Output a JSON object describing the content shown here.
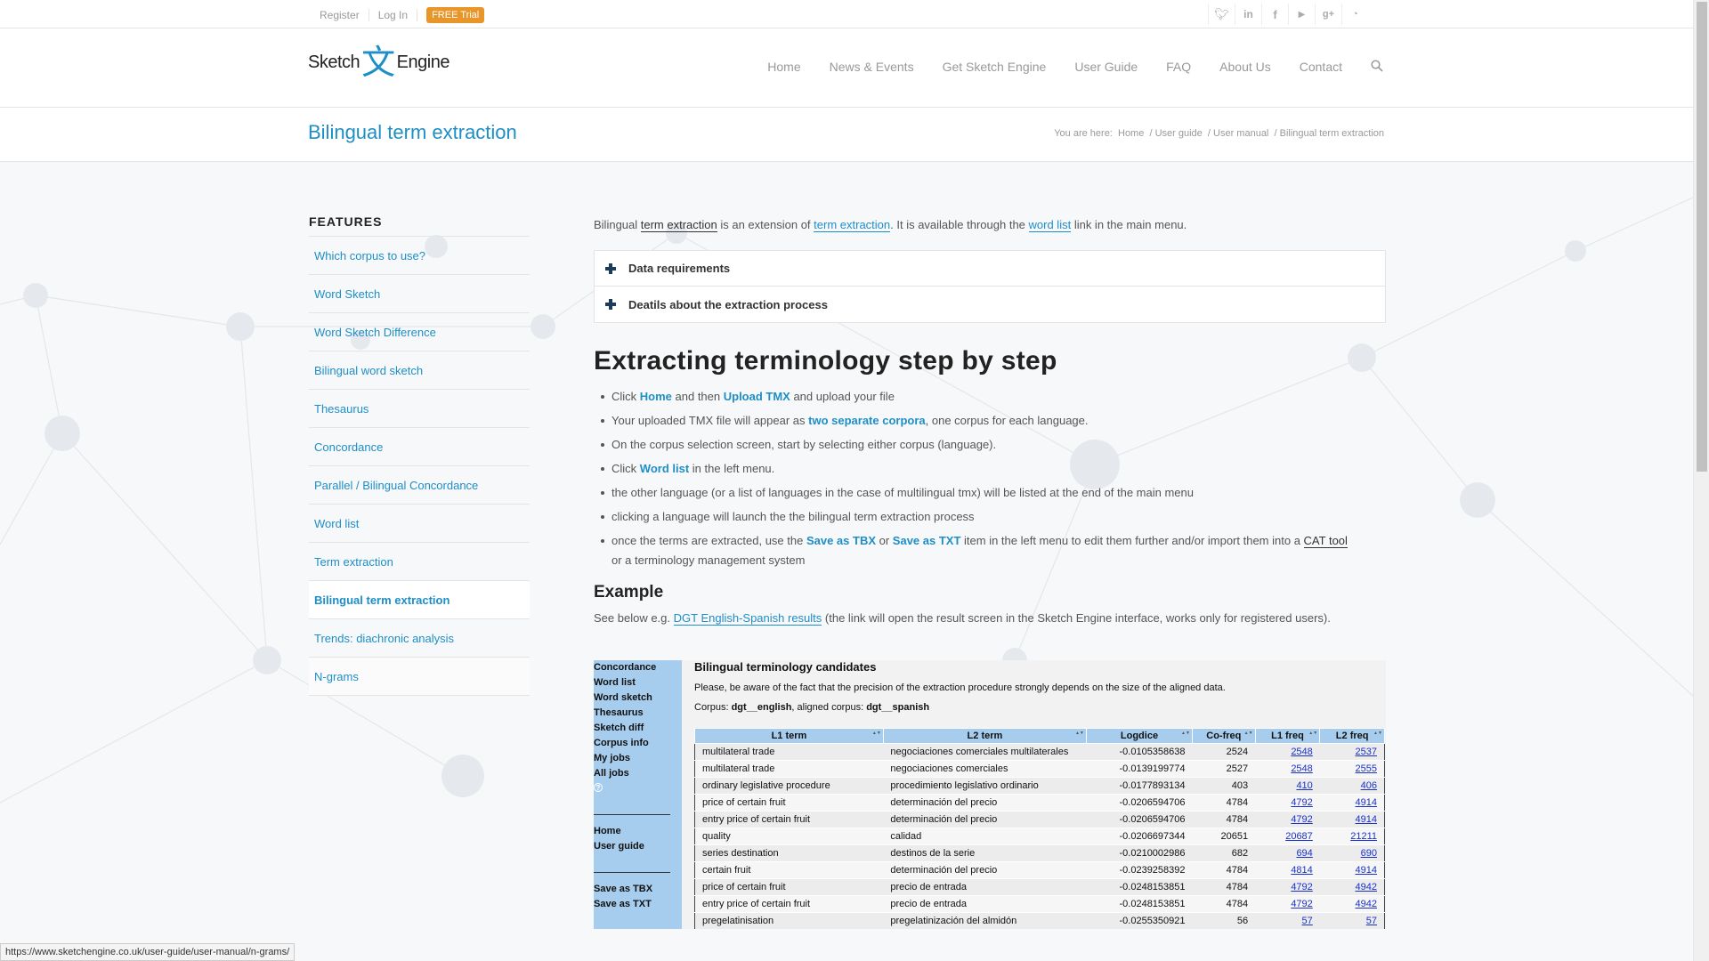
{
  "topbar": {
    "register": "Register",
    "login": "Log In",
    "trial": "FREE Trial",
    "social": [
      "twitter-icon",
      "linkedin-icon",
      "facebook-icon",
      "youtube-icon",
      "googleplus-icon",
      "rss-icon"
    ]
  },
  "logo": {
    "part1": "Sketch",
    "mark": "文",
    "part2": "Engine"
  },
  "nav": [
    "Home",
    "News & Events",
    "Get Sketch Engine",
    "User Guide",
    "FAQ",
    "About Us",
    "Contact"
  ],
  "page": {
    "title": "Bilingual term extraction"
  },
  "breadcrumb": {
    "prefix": "You are here:",
    "items": [
      "Home",
      "User guide",
      "User manual",
      "Bilingual term extraction"
    ]
  },
  "sidebar": {
    "heading": "FEATURES",
    "items": [
      "Which corpus to use?",
      "Word Sketch",
      "Word Sketch Difference",
      "Bilingual word sketch",
      "Thesaurus",
      "Concordance",
      "Parallel / Bilingual Concordance",
      "Word list",
      "Term extraction",
      "Bilingual term extraction",
      "Trends: diachronic analysis",
      "N-grams"
    ]
  },
  "intro": {
    "t1": "Bilingual ",
    "l1": "term extraction",
    "t2": " is an extension of ",
    "l2": "term extraction",
    "t3": ". It is available through the ",
    "l3": "word list",
    "t4": " link in the main menu."
  },
  "toggles": [
    "Data requirements",
    "Deatils about the extraction process"
  ],
  "section_title": "Extracting terminology step by step",
  "steps": {
    "s1a": "Click ",
    "s1b": "Home",
    "s1c": " and then ",
    "s1d": "Upload TMX",
    "s1e": " and upload your file",
    "s2a": "Your uploaded TMX file will appear as ",
    "s2b": "two separate corpora",
    "s2c": ", one corpus for each language.",
    "s3": "On the corpus selection screen, start by selecting either corpus (language).",
    "s4a": "Click ",
    "s4b": "Word list",
    "s4c": " in the left menu.",
    "s5": "the other language (or a list of languages in the case of multilingual tmx) will be listed at the end of the main menu",
    "s6": "clicking a language will launch the the bilingual term extraction process",
    "s7a": "once the terms are extracted, use the ",
    "s7b": "Save as TBX",
    "s7c": " or ",
    "s7d": "Save as TXT",
    "s7e": " item in the left menu to edit them further and/or import them into a ",
    "s7f": "CAT tool",
    "s7g": " or a terminology management system"
  },
  "example": {
    "title": "Example",
    "t1": "See below e.g. ",
    "link": "DGT English-Spanish results",
    "t2": " (the link will open the result screen in the Sketch Engine interface, works only for registered users)."
  },
  "screenshot": {
    "menu_top": [
      "Concordance",
      "Word list",
      "Word sketch",
      "Thesaurus",
      "Sketch diff",
      "Corpus info",
      "My jobs",
      "All jobs"
    ],
    "help": "?",
    "menu_mid": [
      "Home",
      "User guide"
    ],
    "menu_bot": [
      "Save as TBX",
      "Save as TXT"
    ],
    "title": "Bilingual terminology candidates",
    "note": "Please, be aware of the fact that the precision of the extraction procedure strongly depends on the size of the aligned data.",
    "corpus_prefix": "Corpus: ",
    "corpus": "dgt__english",
    "aligned_prefix": ", aligned corpus: ",
    "aligned": "dgt__spanish",
    "headers": [
      "L1 term",
      "L2 term",
      "Logdice",
      "Co-freq",
      "L1 freq",
      "L2 freq"
    ],
    "rows": [
      [
        "multilateral trade",
        "negociaciones comerciales multilaterales",
        "-0.0105358638",
        "2524",
        "2548",
        "2537"
      ],
      [
        "multilateral trade",
        "negociaciones comerciales",
        "-0.0139199774",
        "2527",
        "2548",
        "2555"
      ],
      [
        "ordinary legislative procedure",
        "procedimiento legislativo ordinario",
        "-0.0177893134",
        "403",
        "410",
        "406"
      ],
      [
        "price of certain fruit",
        "determinación del precio",
        "-0.0206594706",
        "4784",
        "4792",
        "4914"
      ],
      [
        "entry price of certain fruit",
        "determinación del precio",
        "-0.0206594706",
        "4784",
        "4792",
        "4914"
      ],
      [
        "quality",
        "calidad",
        "-0.0206697344",
        "20651",
        "20687",
        "21211"
      ],
      [
        "series destination",
        "destinos de la serie",
        "-0.0210002986",
        "682",
        "694",
        "690"
      ],
      [
        "certain fruit",
        "determinación del precio",
        "-0.0239258392",
        "4784",
        "4814",
        "4914"
      ],
      [
        "price of certain fruit",
        "precio de entrada",
        "-0.0248153851",
        "4784",
        "4792",
        "4942"
      ],
      [
        "entry price of certain fruit",
        "precio de entrada",
        "-0.0248153851",
        "4784",
        "4792",
        "4942"
      ],
      [
        "pregelatinisation",
        "pregelatinización del almidón",
        "-0.0255350921",
        "56",
        "57",
        "57"
      ]
    ]
  },
  "statusbar": "https://www.sketchengine.co.uk/user-guide/user-manual/n-grams/",
  "colors": {
    "accent": "#1e8ec7",
    "trial": "#e8962a",
    "table_header": "#a7cdee"
  }
}
